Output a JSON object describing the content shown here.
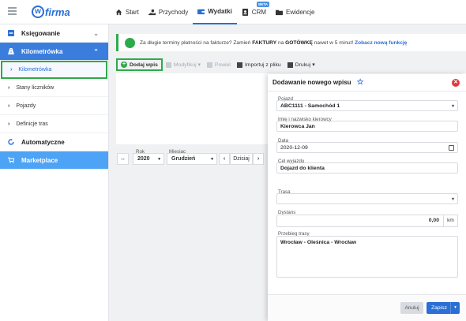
{
  "app": {
    "logo_letter": "w",
    "logo_text": "firma"
  },
  "topnav": [
    {
      "label": "Start",
      "icon": "home-icon",
      "active": false
    },
    {
      "label": "Przychody",
      "icon": "hand-coin-icon",
      "active": false
    },
    {
      "label": "Wydatki",
      "icon": "wallet-icon",
      "active": true
    },
    {
      "label": "CRM",
      "icon": "contact-card-icon",
      "active": false,
      "badge": "BETA"
    },
    {
      "label": "Ewidencje",
      "icon": "folder-icon",
      "active": false
    }
  ],
  "sidebar": {
    "sections": [
      {
        "label": "Księgowanie",
        "icon": "minus-box-icon"
      },
      {
        "label": "Kilometrówka",
        "icon": "road-icon"
      }
    ],
    "items": [
      {
        "label": "Kilometrówka",
        "selected": true
      },
      {
        "label": "Stany liczników",
        "selected": false
      },
      {
        "label": "Pojazdy",
        "selected": false
      },
      {
        "label": "Definicje tras",
        "selected": false
      }
    ],
    "automatyczne": "Automatyczne",
    "marketplace": "Marketplace"
  },
  "notice": {
    "text_before": "Za długie terminy płatności na fakturze? Zamień ",
    "bold1": "FAKTURY",
    "text_mid": " na ",
    "bold2": "GOTÓWKĘ",
    "text_after": " nawet w 5 minut! ",
    "link": "Zobacz nową funkcję"
  },
  "toolbar": {
    "add": "Dodaj wpis",
    "modify": "Modyfikuj",
    "repeat": "Powiel",
    "import": "Importuj z pliku",
    "print": "Drukuj"
  },
  "filters": {
    "year_label": "Rok",
    "year_value": "2020",
    "month_label": "Miesiąc",
    "month_value": "Grudzień",
    "today": "Dzisiaj"
  },
  "modal": {
    "title": "Dodawanie nowego wpisu",
    "fields": {
      "vehicle_label": "Pojazd",
      "vehicle_value": "ABC1111 - Samochód 1",
      "driver_label": "Imię i nazwisko kierowcy",
      "driver_value": "Kierowca Jan",
      "date_label": "Data",
      "date_value": "2020-12-09",
      "purpose_label": "Cel wyjazdu",
      "purpose_value": "Dojazd do klienta",
      "route_label": "Trasa",
      "route_value": "",
      "distance_label": "Dystans",
      "distance_value": "0,00",
      "distance_unit": "km",
      "path_label": "Przebieg trasy",
      "path_value": "Wrocław - Oleśnica - Wrocław"
    },
    "cancel": "Anuluj",
    "save": "Zapisz"
  },
  "colors": {
    "accent": "#2a6fd6",
    "green": "#2eaa4a",
    "sidebar_active": "#3b7ddd",
    "marketplace": "#4da3f5",
    "close": "#e0383e"
  }
}
